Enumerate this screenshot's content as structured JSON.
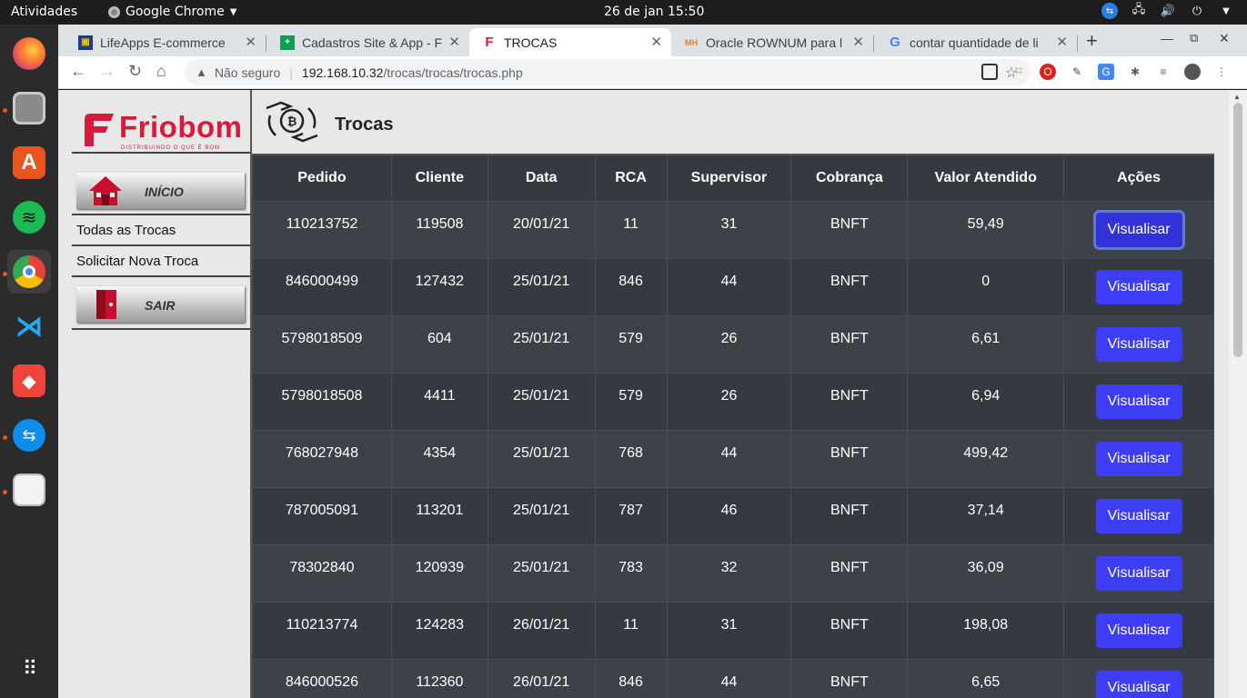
{
  "topbar": {
    "activities": "Atividades",
    "app_name": "Google Chrome",
    "clock": "26 de jan  15:50"
  },
  "dock": {
    "items": [
      "firefox-icon",
      "files-icon",
      "app-store-icon",
      "spotify-icon",
      "chrome-icon",
      "vscode-icon",
      "anydesk-icon",
      "teamviewer-icon",
      "document-viewer-icon",
      "app-grid-icon"
    ]
  },
  "browser": {
    "tabs": [
      {
        "title": "LifeApps E-commerce"
      },
      {
        "title": "Cadastros Site & App - F"
      },
      {
        "title": "TROCAS"
      },
      {
        "title": "Oracle ROWNUM para l"
      },
      {
        "title": "contar quantidade de li"
      }
    ],
    "security": "Não seguro",
    "url_host": "192.168.10.32",
    "url_path": "/trocas/trocas/trocas.php"
  },
  "sidebar": {
    "logo": "Friobom",
    "logo_tagline": "DISTRIBUINDO O QUE É BOM",
    "home_label": "INÍCIO",
    "links": [
      "Todas as Trocas",
      "Solicitar Nova Troca"
    ],
    "exit_label": "SAIR"
  },
  "header": {
    "title": "Trocas"
  },
  "table": {
    "columns": [
      "Pedido",
      "Cliente",
      "Data",
      "RCA",
      "Supervisor",
      "Cobrança",
      "Valor Atendido",
      "Ações"
    ],
    "action_label": "Visualisar",
    "rows": [
      [
        "110213752",
        "119508",
        "20/01/21",
        "11",
        "31",
        "BNFT",
        "59,49"
      ],
      [
        "846000499",
        "127432",
        "25/01/21",
        "846",
        "44",
        "BNFT",
        "0"
      ],
      [
        "5798018509",
        "604",
        "25/01/21",
        "579",
        "26",
        "BNFT",
        "6,61"
      ],
      [
        "5798018508",
        "4411",
        "25/01/21",
        "579",
        "26",
        "BNFT",
        "6,94"
      ],
      [
        "768027948",
        "4354",
        "25/01/21",
        "768",
        "44",
        "BNFT",
        "499,42"
      ],
      [
        "787005091",
        "113201",
        "25/01/21",
        "787",
        "46",
        "BNFT",
        "37,14"
      ],
      [
        "78302840",
        "120939",
        "25/01/21",
        "783",
        "32",
        "BNFT",
        "36,09"
      ],
      [
        "110213774",
        "124283",
        "26/01/21",
        "11",
        "31",
        "BNFT",
        "198,08"
      ],
      [
        "846000526",
        "112360",
        "26/01/21",
        "846",
        "44",
        "BNFT",
        "6,65"
      ]
    ]
  }
}
